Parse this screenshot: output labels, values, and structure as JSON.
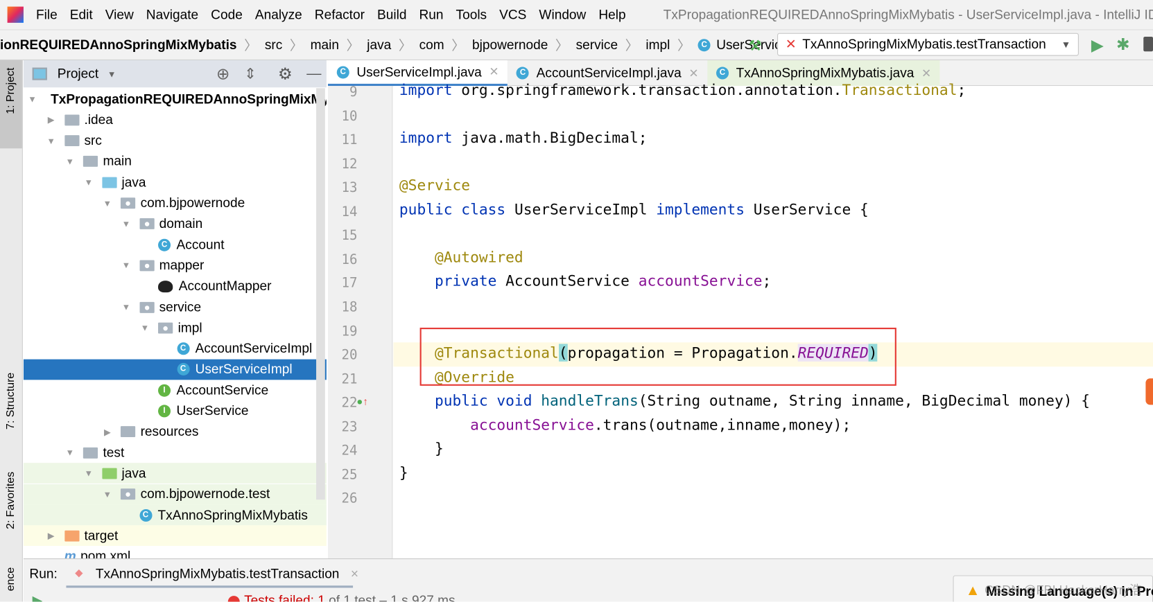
{
  "menubar": {
    "items": [
      "File",
      "Edit",
      "View",
      "Navigate",
      "Code",
      "Analyze",
      "Refactor",
      "Build",
      "Run",
      "Tools",
      "VCS",
      "Window",
      "Help"
    ],
    "title": "TxPropagationREQUIREDAnnoSpringMixMybatis - UserServiceImpl.java - IntelliJ IDEA"
  },
  "breadcrumbs": [
    "ionREQUIREDAnnoSpringMixMybatis",
    "src",
    "main",
    "java",
    "com",
    "bjpowernode",
    "service",
    "impl",
    "UserServiceImpl"
  ],
  "run_config": "TxAnnoSpringMixMybatis.testTransaction",
  "tool_stripe": {
    "project": "1: Project",
    "structure": "7: Structure",
    "favorites": "2: Favorites",
    "persistence": "ence"
  },
  "project_panel": {
    "title": "Project"
  },
  "tree": [
    {
      "label": "TxPropagationREQUIREDAnnoSpringMixMybatis",
      "level": 0,
      "arrow": "down",
      "icon": "module",
      "bold": true
    },
    {
      "label": ".idea",
      "level": 1,
      "arrow": "right",
      "icon": "folder"
    },
    {
      "label": "src",
      "level": 1,
      "arrow": "down",
      "icon": "folder"
    },
    {
      "label": "main",
      "level": 2,
      "arrow": "down",
      "icon": "folder"
    },
    {
      "label": "java",
      "level": 3,
      "arrow": "down",
      "icon": "source-folder"
    },
    {
      "label": "com.bjpowernode",
      "level": 4,
      "arrow": "down",
      "icon": "package"
    },
    {
      "label": "domain",
      "level": 5,
      "arrow": "down",
      "icon": "package"
    },
    {
      "label": "Account",
      "level": 6,
      "icon": "class"
    },
    {
      "label": "mapper",
      "level": 5,
      "arrow": "down",
      "icon": "package"
    },
    {
      "label": "AccountMapper",
      "level": 6,
      "icon": "mybatis"
    },
    {
      "label": "service",
      "level": 5,
      "arrow": "down",
      "icon": "package"
    },
    {
      "label": "impl",
      "level": 6,
      "arrow": "down",
      "icon": "package"
    },
    {
      "label": "AccountServiceImpl",
      "level": 7,
      "icon": "class"
    },
    {
      "label": "UserServiceImpl",
      "level": 7,
      "icon": "class",
      "selected": true
    },
    {
      "label": "AccountService",
      "level": 6,
      "icon": "interface"
    },
    {
      "label": "UserService",
      "level": 6,
      "icon": "interface"
    },
    {
      "label": "resources",
      "level": 4,
      "arrow": "right",
      "icon": "resources-folder"
    },
    {
      "label": "test",
      "level": 2,
      "arrow": "down",
      "icon": "folder"
    },
    {
      "label": "java",
      "level": 3,
      "arrow": "down",
      "icon": "test-folder",
      "green": true
    },
    {
      "label": "com.bjpowernode.test",
      "level": 4,
      "arrow": "down",
      "icon": "package",
      "green": true
    },
    {
      "label": "TxAnnoSpringMixMybatis",
      "level": 5,
      "icon": "test-class",
      "green": true
    },
    {
      "label": "target",
      "level": 1,
      "arrow": "right",
      "icon": "excluded-folder",
      "yellow": true
    },
    {
      "label": "pom.xml",
      "level": 1,
      "icon": "maven"
    }
  ],
  "tabs": [
    {
      "label": "UserServiceImpl.java",
      "active": true
    },
    {
      "label": "AccountServiceImpl.java"
    },
    {
      "label": "TxAnnoSpringMixMybatis.java",
      "green": true
    }
  ],
  "code": [
    {
      "n": "9",
      "t": [
        [
          "import ",
          "kw"
        ],
        [
          "org.springframework.transaction.annotation.",
          "pl"
        ],
        [
          "Transactional",
          "an"
        ],
        [
          ";",
          "pl"
        ]
      ]
    },
    {
      "n": "10",
      "t": []
    },
    {
      "n": "11",
      "t": [
        [
          "import ",
          "kw"
        ],
        [
          "java.math.BigDecimal;",
          "pl"
        ]
      ]
    },
    {
      "n": "12",
      "t": []
    },
    {
      "n": "13",
      "t": [
        [
          "@Service",
          "an"
        ]
      ]
    },
    {
      "n": "14",
      "t": [
        [
          "public class ",
          "kw"
        ],
        [
          "UserServiceImpl ",
          "pl"
        ],
        [
          "implements ",
          "kw"
        ],
        [
          "UserService {",
          "pl"
        ]
      ]
    },
    {
      "n": "15",
      "t": []
    },
    {
      "n": "16",
      "t": [
        [
          "    ",
          "pl"
        ],
        [
          "@Autowired",
          "an"
        ]
      ]
    },
    {
      "n": "17",
      "t": [
        [
          "    ",
          "pl"
        ],
        [
          "private ",
          "kw"
        ],
        [
          "AccountService ",
          "pl"
        ],
        [
          "accountService",
          "fd"
        ],
        [
          ";",
          "pl"
        ]
      ]
    },
    {
      "n": "18",
      "t": []
    },
    {
      "n": "19",
      "t": []
    },
    {
      "n": "20",
      "t": [
        [
          "    ",
          "pl"
        ],
        [
          "@Transactional",
          "an"
        ],
        [
          "(",
          "brk"
        ],
        [
          "propagation = Propagation.",
          "pl"
        ],
        [
          "REQUIRED",
          "it"
        ],
        [
          ")",
          "brk"
        ]
      ]
    },
    {
      "n": "21",
      "t": [
        [
          "    ",
          "pl"
        ],
        [
          "@Override",
          "an"
        ]
      ]
    },
    {
      "n": "22",
      "t": [
        [
          "    ",
          "pl"
        ],
        [
          "public void ",
          "kw"
        ],
        [
          "handleTrans",
          "mt"
        ],
        [
          "(String outname, String inname, BigDecimal money) {",
          "pl"
        ]
      ]
    },
    {
      "n": "23",
      "t": [
        [
          "        ",
          "pl"
        ],
        [
          "accountService",
          "fd"
        ],
        [
          ".trans(outname,inname,money);",
          "pl"
        ]
      ]
    },
    {
      "n": "24",
      "t": [
        [
          "    }",
          "pl"
        ]
      ]
    },
    {
      "n": "25",
      "t": [
        [
          "}",
          "pl"
        ]
      ]
    },
    {
      "n": "26",
      "t": []
    }
  ],
  "run_panel": {
    "label": "Run:",
    "tab": "TxAnnoSpringMixMybatis.testTransaction",
    "status_prefix": "Tests failed: 1",
    "status_suffix": "of 1 test – 1 s 927 ms"
  },
  "notification": {
    "text": "Missing Language(s) in Pro",
    "watermark": "CSDN @FBI HackerHarry浩"
  },
  "colors": {
    "selection": "#2675bf",
    "error": "#e53935",
    "current_line": "#fffae3"
  }
}
